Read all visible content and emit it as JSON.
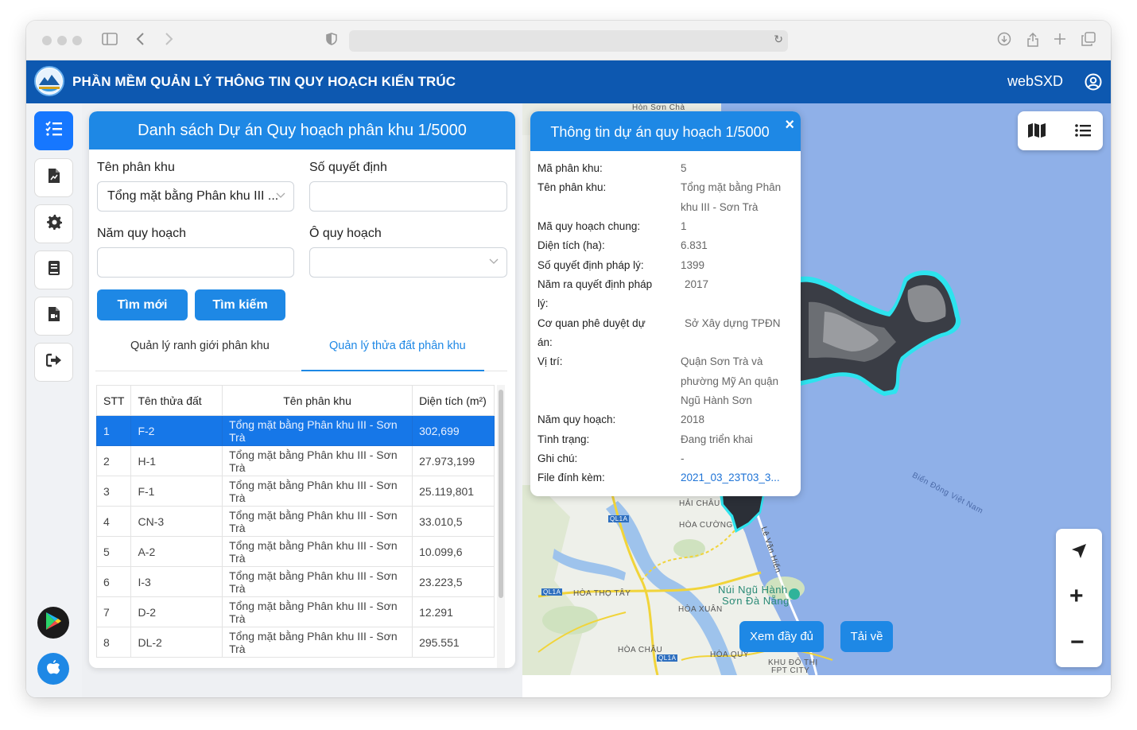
{
  "app": {
    "title": "PHẦN MỀM QUẢN LÝ THÔNG TIN QUY HOẠCH KIẾN TRÚC",
    "user": "webSXD"
  },
  "panel": {
    "title": "Danh sách Dự án Quy hoạch phân khu 1/5000",
    "labels": {
      "ten_phan_khu": "Tên phân khu",
      "so_quyet_dinh": "Số quyết định",
      "nam_quy_hoach": "Năm quy hoạch",
      "o_quy_hoach": "Ô quy hoạch"
    },
    "values": {
      "ten_phan_khu": "Tổng mặt bằng Phân khu III ...",
      "so_quyet_dinh": "",
      "nam_quy_hoach": "",
      "o_quy_hoach": ""
    },
    "buttons": {
      "reset": "Tìm mới",
      "search": "Tìm kiếm"
    },
    "tabs": [
      "Quản lý ranh giới phân khu",
      "Quản lý thửa đất phân khu"
    ],
    "active_tab": 1,
    "table": {
      "headers": [
        "STT",
        "Tên thửa đất",
        "Tên phân khu",
        "Diện tích (m²)"
      ],
      "rows": [
        [
          "1",
          "F-2",
          "Tổng mặt bằng Phân khu III - Sơn Trà",
          "302,699"
        ],
        [
          "2",
          "H-1",
          "Tổng mặt bằng Phân khu III - Sơn Trà",
          "27.973,199"
        ],
        [
          "3",
          "F-1",
          "Tổng mặt bằng Phân khu III - Sơn Trà",
          "25.119,801"
        ],
        [
          "4",
          "CN-3",
          "Tổng mặt bằng Phân khu III - Sơn Trà",
          "33.010,5"
        ],
        [
          "5",
          "A-2",
          "Tổng mặt bằng Phân khu III - Sơn Trà",
          "10.099,6"
        ],
        [
          "6",
          "I-3",
          "Tổng mặt bằng Phân khu III - Sơn Trà",
          "23.223,5"
        ],
        [
          "7",
          "D-2",
          "Tổng mặt bằng Phân khu III - Sơn Trà",
          "12.291"
        ],
        [
          "8",
          "DL-2",
          "Tổng mặt bằng Phân khu III - Sơn Trà",
          "295.551"
        ]
      ],
      "selected_row": 0
    }
  },
  "popup": {
    "title": "Thông tin dự án quy hoạch 1/5000",
    "close": "×",
    "fields": {
      "ma_phan_khu_k": "Mã phân khu:",
      "ma_phan_khu_v": "5",
      "ten_phan_khu_k": "Tên phân khu:",
      "ten_phan_khu_v1": "Tổng mặt bằng Phân",
      "ten_phan_khu_v2": "khu III - Sơn Trà",
      "ma_qhc_k": "Mã quy hoạch chung:",
      "ma_qhc_v": "1",
      "dien_tich_k": "Diện tích (ha):",
      "dien_tich_v": "6.831",
      "so_qd_k": "Số quyết định pháp lý:",
      "so_qd_v": "1399",
      "nam_qd_k1": "Năm ra quyết định pháp",
      "nam_qd_k2": "lý:",
      "nam_qd_v": "2017",
      "co_quan_k1": "Cơ quan phê duyệt dự",
      "co_quan_k2": "án:",
      "co_quan_v": "Sở Xây dựng TPĐN",
      "vi_tri_k": "Vị trí:",
      "vi_tri_v1": "Quận Sơn Trà và",
      "vi_tri_v2": "phường Mỹ An quận",
      "vi_tri_v3": "Ngũ Hành Sơn",
      "nam_qh_k": "Năm quy hoạch:",
      "nam_qh_v": "2018",
      "tinh_trang_k": "Tình trạng:",
      "tinh_trang_v": "Đang triển khai",
      "ghi_chu_k": "Ghi chú:",
      "ghi_chu_v": "-",
      "file_k": "File đính kèm:",
      "file_v": "2021_03_23T03_3..."
    }
  },
  "map": {
    "labels": {
      "hon_son_cha": "Hòn Sơn Chà",
      "bien_dong": "Biển Đông Việt Nam",
      "hai_chau": "HẢI CHÂU",
      "hoa_cuong": "HÒA CƯỜNG",
      "hoa_tho_tay": "HÒA THỌ TÂY",
      "hoa_xuan": "HÒA XUÂN",
      "hoa_chau": "HÒA CHÂU",
      "hoa_quy": "HÒA QUÝ",
      "nui_ngu_hanh_son": "Núi Ngũ Hành",
      "nui_ngu_hanh_son2": "Sơn Đà Nẵng",
      "le_van_hien": "Lê Văn Hiến",
      "khu_do_thi": "KHU ĐÔ THỊ",
      "fpt_city": "FPT CITY",
      "ql1a_1": "QL1A",
      "ql1a_2": "QL1A",
      "ql1a_3": "QL1A"
    },
    "buttons": {
      "view_full": "Xem đầy đủ",
      "download": "Tải về"
    },
    "controls": {
      "zoom_in": "+",
      "zoom_out": "−"
    }
  },
  "colors": {
    "header_blue": "#0d58b0",
    "primary": "#1e88e5",
    "selected_row": "#1677e8",
    "sea": "#8fb0e8",
    "land": "#eef0ea",
    "highlight_outline": "#2de3ee"
  },
  "icons": {
    "sidebar": [
      "list-check-icon",
      "file-chart-icon",
      "gear-icon",
      "book-icon",
      "file-video-icon",
      "logout-icon"
    ],
    "stores": [
      "google-play-icon",
      "apple-icon"
    ],
    "map": [
      "map-icon",
      "list-icon",
      "location-arrow-icon"
    ]
  }
}
